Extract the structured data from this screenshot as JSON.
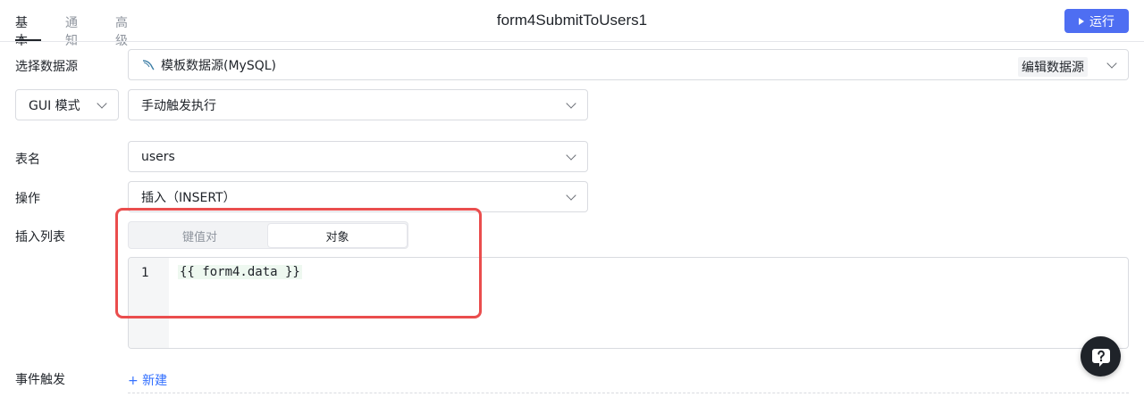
{
  "tabs": [
    {
      "label": "基本",
      "active": true
    },
    {
      "label": "通知",
      "active": false
    },
    {
      "label": "高级",
      "active": false
    }
  ],
  "query_name": "form4SubmitToUsers1",
  "run_button": {
    "label": "运行"
  },
  "datasource": {
    "label": "选择数据源",
    "value": "模板数据源(MySQL)",
    "icon": "mysql-dolphin-icon",
    "edit_label": "编辑数据源"
  },
  "mode_select": {
    "value": "GUI 模式"
  },
  "trigger_select": {
    "value": "手动触发执行"
  },
  "table": {
    "label": "表名",
    "value": "users"
  },
  "operation": {
    "label": "操作",
    "value": "插入（INSERT）"
  },
  "insert_list": {
    "label": "插入列表",
    "options": [
      "键值对",
      "对象"
    ],
    "selected": "对象"
  },
  "editor": {
    "line_number": "1",
    "code": "{{ form4.data }}"
  },
  "events": {
    "label": "事件触发",
    "add_label": "+ 新建"
  },
  "colors": {
    "accent": "#4e6ef2",
    "highlight": "#ea4d4d",
    "link": "#3370ff"
  }
}
